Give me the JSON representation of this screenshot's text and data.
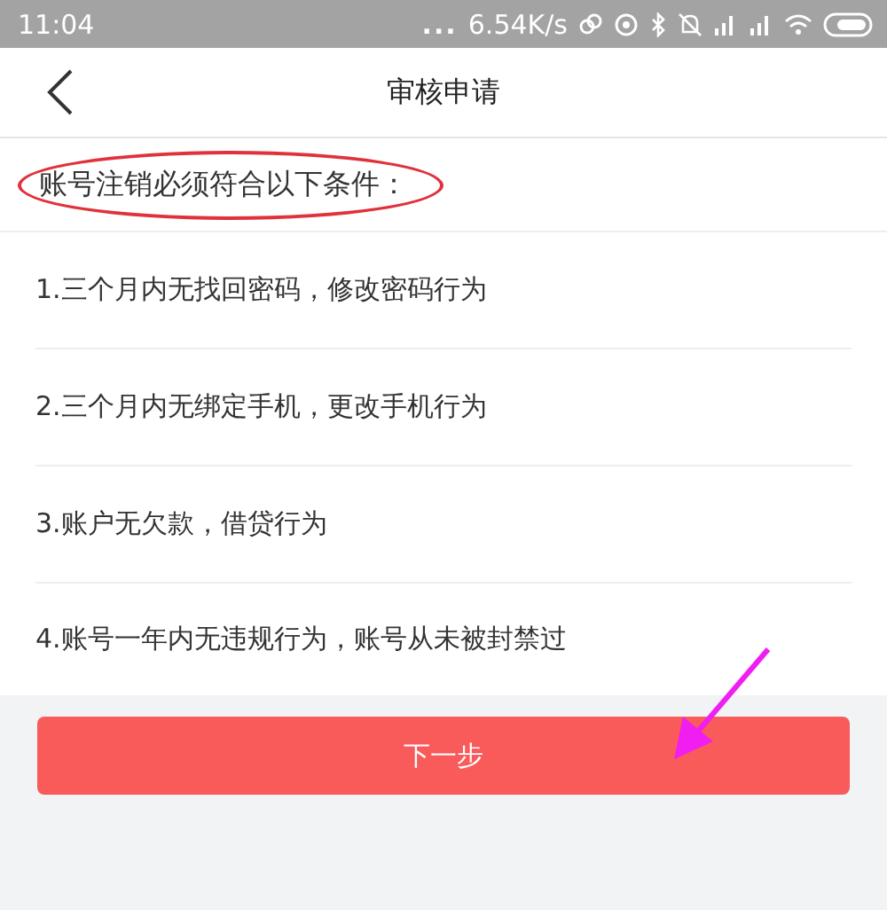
{
  "status_bar": {
    "time": "11:04",
    "more": "...",
    "speed": "6.54K/s"
  },
  "header": {
    "title": "审核申请"
  },
  "conditions": {
    "heading": "账号注销必须符合以下条件：",
    "items": [
      "1.三个月内无找回密码，修改密码行为",
      "2.三个月内无绑定手机，更改手机行为",
      "3.账户无欠款，借贷行为",
      "4.账号一年内无违规行为，账号从未被封禁过"
    ]
  },
  "next_button": "下一步"
}
